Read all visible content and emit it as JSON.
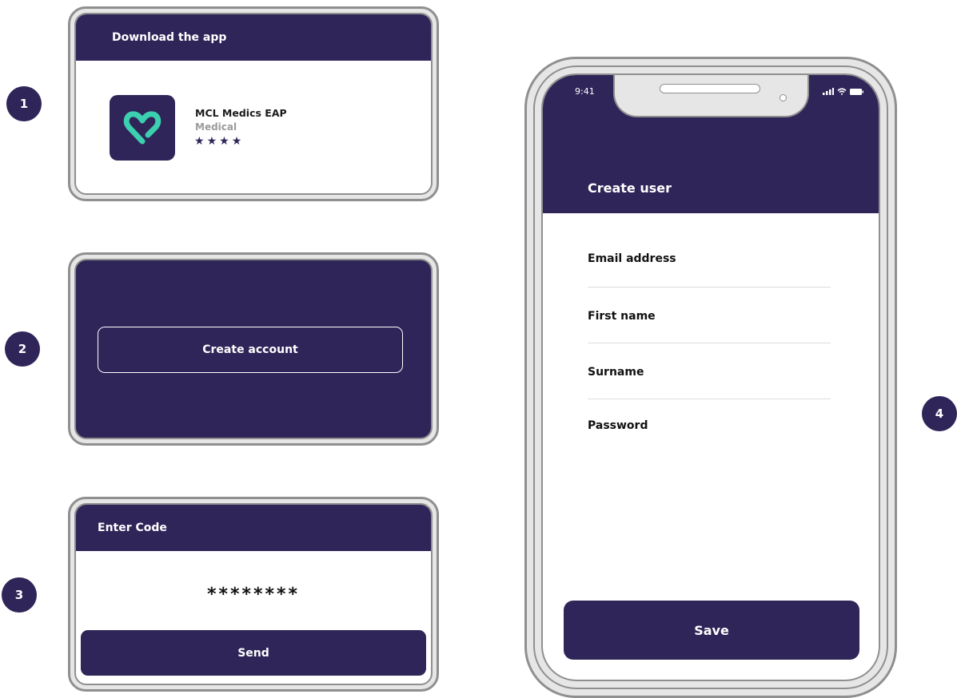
{
  "steps": [
    "1",
    "2",
    "3",
    "4"
  ],
  "download_card": {
    "title": "Download the app",
    "app_name": "MCL Medics EAP",
    "category": "Medical",
    "stars": [
      "★",
      "★",
      "★",
      "★"
    ]
  },
  "account_card": {
    "button_label": "Create account"
  },
  "code_card": {
    "title": "Enter Code",
    "code_value": "********",
    "send_label": "Send"
  },
  "phone": {
    "status_time": "9:41",
    "screen_title": "Create user",
    "fields": [
      {
        "label": "Email address"
      },
      {
        "label": "First name"
      },
      {
        "label": "Surname"
      },
      {
        "label": "Password"
      }
    ],
    "save_label": "Save"
  },
  "colors": {
    "brand": "#2f2558",
    "accent": "#3ccfb0",
    "frame": "#e6e6e6"
  }
}
